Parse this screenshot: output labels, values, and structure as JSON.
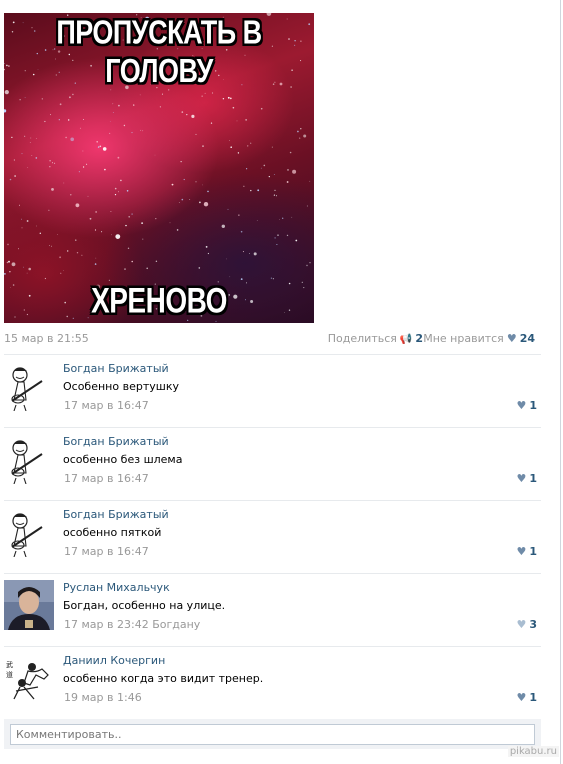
{
  "post": {
    "meme_top_text": "ПРОПУСКАТЬ В ГОЛОВУ",
    "meme_bottom_text": "ХРЕНОВО",
    "date": "15 мар в 21:55",
    "share_label": "Поделиться",
    "share_count": "2",
    "like_label": "Мне нравится",
    "like_count": "24"
  },
  "comments": [
    {
      "author": "Богдан Брижатый",
      "text": "Особенно вертушку",
      "date": "17 мар в 16:47",
      "likes": "1",
      "avatar": "guitarist-avatar"
    },
    {
      "author": "Богдан Брижатый",
      "text": "особенно без шлема",
      "date": "17 мар в 16:47",
      "likes": "1",
      "avatar": "guitarist-avatar"
    },
    {
      "author": "Богдан Брижатый",
      "text": "особенно пяткой",
      "date": "17 мар в 16:47",
      "likes": "1",
      "avatar": "guitarist-avatar"
    },
    {
      "author": "Руслан Михальчук",
      "text": "Богдан, особенно на улице.",
      "date": "17 мар в 23:42 Богдану",
      "likes": "3",
      "avatar": "photo-avatar"
    },
    {
      "author": "Даниил Кочергин",
      "text": "особенно когда это видит тренер.",
      "date": "19 мар в 1:46",
      "likes": "1",
      "avatar": "judo-avatar"
    }
  ],
  "composer": {
    "placeholder": "Комментировать.."
  },
  "watermark": "pikabu.ru",
  "colors": {
    "link": "#2b587a",
    "meta": "#999999",
    "heart": "#6f8ba8"
  }
}
